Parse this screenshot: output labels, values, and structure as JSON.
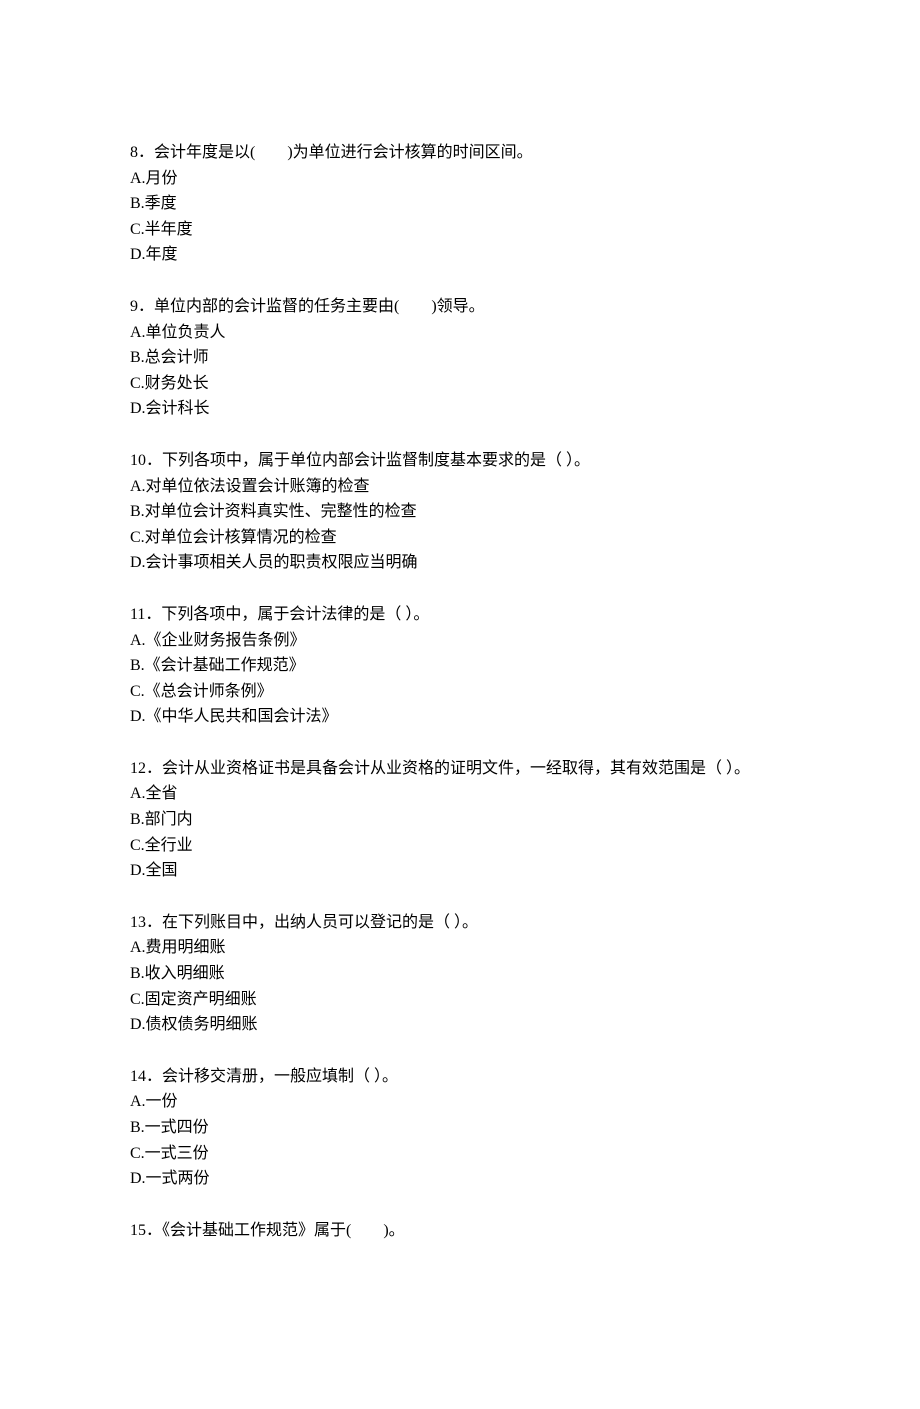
{
  "questions": [
    {
      "number": "8．",
      "text": "会计年度是以(　　)为单位进行会计核算的时间区间。",
      "options": [
        "A.月份",
        "B.季度",
        "C.半年度",
        "D.年度"
      ]
    },
    {
      "number": "9．",
      "text": "单位内部的会计监督的任务主要由(　　)领导。",
      "options": [
        "A.单位负责人",
        "B.总会计师",
        "C.财务处长",
        "D.会计科长"
      ]
    },
    {
      "number": "10．",
      "text": "下列各项中，属于单位内部会计监督制度基本要求的是（ ）。",
      "options": [
        "A.对单位依法设置会计账簿的检查",
        "B.对单位会计资料真实性、完整性的检查",
        "C.对单位会计核算情况的检查",
        "D.会计事项相关人员的职责权限应当明确"
      ]
    },
    {
      "number": "11．",
      "text": "下列各项中，属于会计法律的是（ ）。",
      "options": [
        "A.《企业财务报告条例》",
        "B.《会计基础工作规范》",
        "C.《总会计师条例》",
        "D.《中华人民共和国会计法》"
      ]
    },
    {
      "number": "12．",
      "text": "会计从业资格证书是具备会计从业资格的证明文件，一经取得，其有效范围是（ ）。",
      "options": [
        "A.全省",
        "B.部门内",
        "C.全行业",
        "D.全国"
      ]
    },
    {
      "number": "13．",
      "text": "在下列账目中，出纳人员可以登记的是（ ）。",
      "options": [
        "A.费用明细账",
        "B.收入明细账",
        "C.固定资产明细账",
        "D.债权债务明细账"
      ]
    },
    {
      "number": "14．",
      "text": "会计移交清册，一般应填制（ ）。",
      "options": [
        "A.一份",
        "B.一式四份",
        "C.一式三份",
        "D.一式两份"
      ]
    },
    {
      "number": "15．",
      "text": "《会计基础工作规范》属于(　　)。",
      "options": []
    }
  ]
}
